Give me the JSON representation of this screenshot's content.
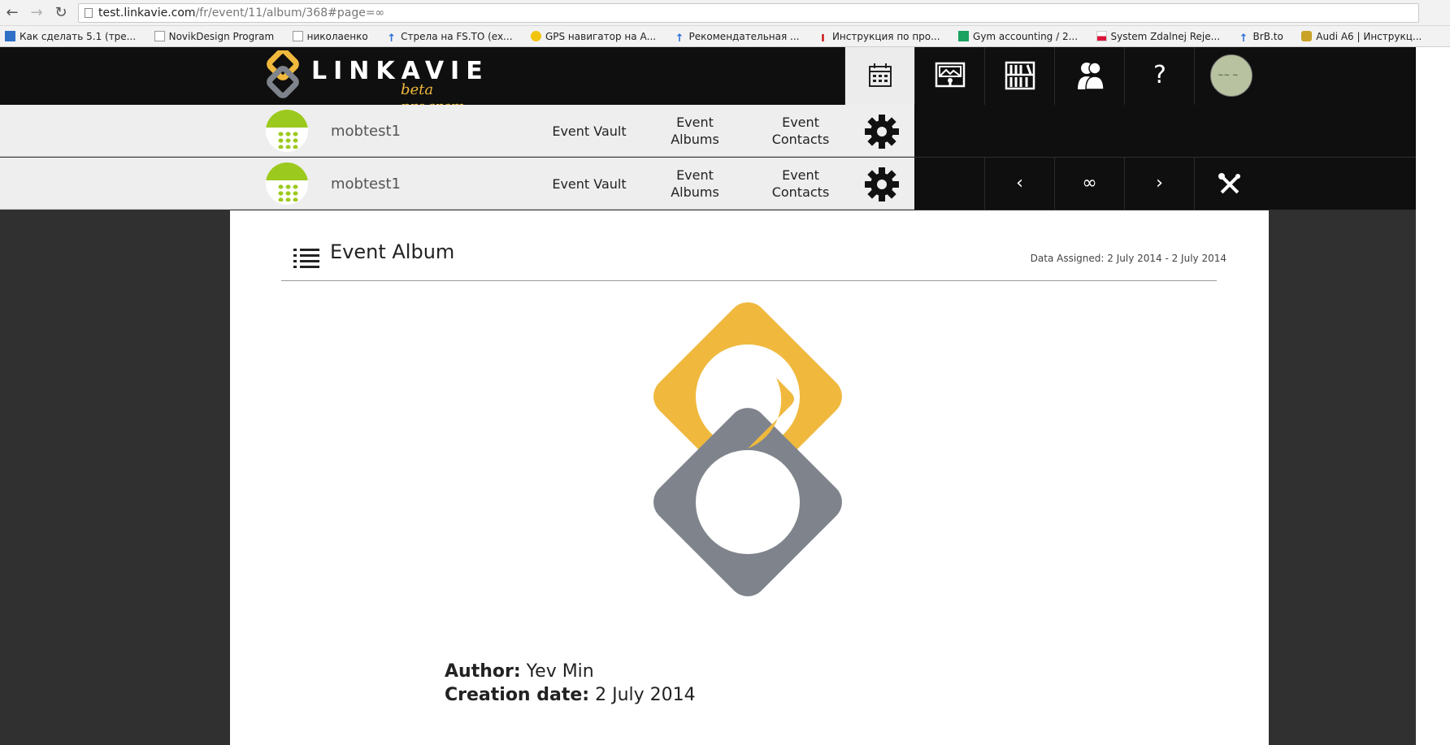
{
  "browser": {
    "url_host": "test.linkavie.com",
    "url_path": "/fr/event/11/album/368#page=∞",
    "bookmarks": [
      {
        "label": "Как сделать 5.1 (тре...",
        "icon": "blue-square-icon"
      },
      {
        "label": "NovikDesign Program",
        "icon": "page-icon"
      },
      {
        "label": "николаенко",
        "icon": "page-icon"
      },
      {
        "label": "Стрела на FS.TO (ex...",
        "icon": "blue-arrow-icon"
      },
      {
        "label": "GPS навигатор на А...",
        "icon": "yellow-pin-icon"
      },
      {
        "label": "Рекомендательная ...",
        "icon": "blue-arrow-icon"
      },
      {
        "label": "Инструкция по про...",
        "icon": "i-icon"
      },
      {
        "label": "Gym accounting / 2...",
        "icon": "sheets-icon"
      },
      {
        "label": "System Zdalnej Reje...",
        "icon": "flag-icon"
      },
      {
        "label": "BrB.to",
        "icon": "blue-arrow-icon"
      },
      {
        "label": "Audi A6 | Инструкц...",
        "icon": "car-icon"
      }
    ]
  },
  "header": {
    "logo_word": "LINKAVIE",
    "logo_sub": "beta program",
    "help_label": "?"
  },
  "subbar": {
    "username": "mobtest1",
    "event_vault": "Event Vault",
    "event_albums": "Event\nAlbums",
    "event_contacts": "Event\nContacts"
  },
  "pager": {
    "prev": "‹",
    "page": "∞",
    "next": "›"
  },
  "album": {
    "title": "Event Album",
    "data_assigned": "Data Assigned: 2 July 2014 - 2 July 2014",
    "author_label": "Author:",
    "author": "Yev Min",
    "creation_label": "Creation date:",
    "creation_date": "2 July 2014"
  },
  "colors": {
    "brand_yellow": "#f0b93e",
    "brand_gray": "#7f848c",
    "avatar_green": "#9cc91e",
    "topbar": "#0f0f0f"
  }
}
